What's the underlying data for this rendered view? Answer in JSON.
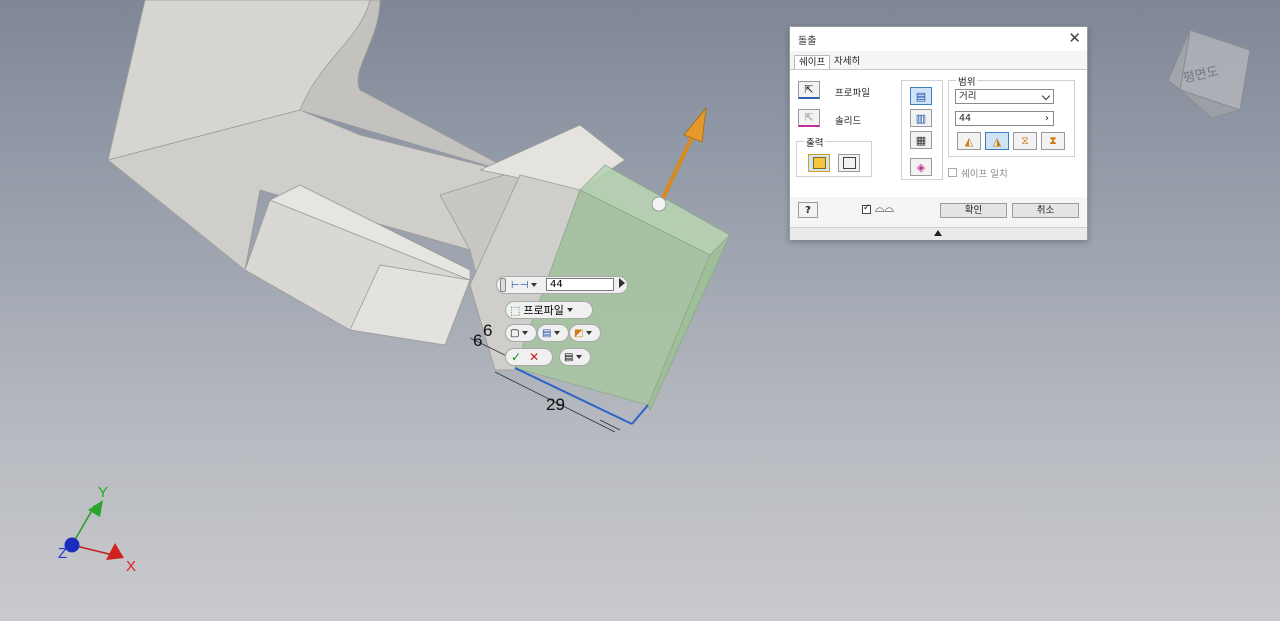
{
  "viewport": {
    "dimension_labels": [
      "6",
      "6",
      "29"
    ],
    "triad": {
      "x": "X",
      "y": "Y",
      "z": "Z"
    },
    "viewcube_label": "평면도"
  },
  "minitoolbar": {
    "distance_value": "44",
    "profile_label": "프로파일"
  },
  "dialog": {
    "title": "돌출",
    "tabs": [
      "쉐이프",
      "자세히"
    ],
    "profile_label": "프로파일",
    "solid_label": "솔리드",
    "output_label": "출력",
    "extents_label": "범위",
    "extents_type": "거리",
    "distance": "44",
    "match_shape_label": "쉐이프 일치",
    "ok_label": "확인",
    "cancel_label": "취소"
  },
  "colors": {
    "extrude_preview": "#a8c7a0",
    "arrow": "#d98a1c",
    "model": "#d4d3cf"
  }
}
